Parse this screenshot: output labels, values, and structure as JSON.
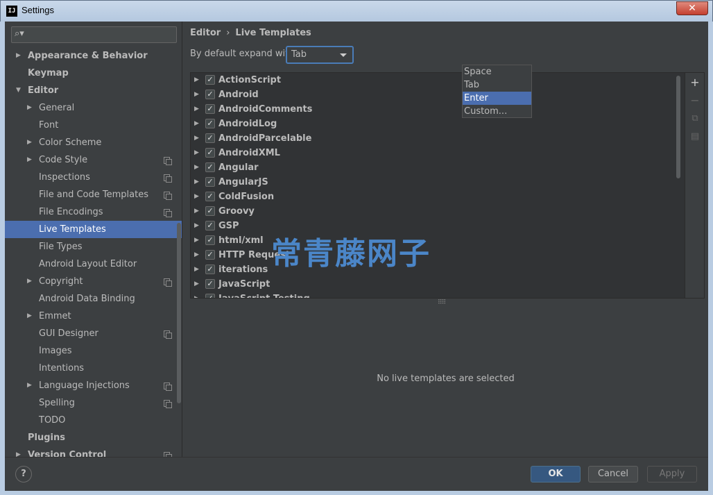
{
  "window": {
    "title": "Settings",
    "app_icon_text": "IJ",
    "close_glyph": "✕"
  },
  "sidebar": {
    "search": {
      "value": "",
      "icon": "search-icon"
    },
    "items": [
      {
        "label": "Appearance & Behavior",
        "level": 0,
        "arrow": "▶",
        "project": false,
        "selected": false
      },
      {
        "label": "Keymap",
        "level": 0,
        "arrow": "",
        "project": false,
        "selected": false
      },
      {
        "label": "Editor",
        "level": 0,
        "arrow": "▼",
        "project": false,
        "selected": false
      },
      {
        "label": "General",
        "level": 1,
        "arrow": "▶",
        "project": false,
        "selected": false
      },
      {
        "label": "Font",
        "level": 1,
        "arrow": "",
        "project": false,
        "selected": false
      },
      {
        "label": "Color Scheme",
        "level": 1,
        "arrow": "▶",
        "project": false,
        "selected": false
      },
      {
        "label": "Code Style",
        "level": 1,
        "arrow": "▶",
        "project": true,
        "selected": false
      },
      {
        "label": "Inspections",
        "level": 1,
        "arrow": "",
        "project": true,
        "selected": false
      },
      {
        "label": "File and Code Templates",
        "level": 1,
        "arrow": "",
        "project": true,
        "selected": false
      },
      {
        "label": "File Encodings",
        "level": 1,
        "arrow": "",
        "project": true,
        "selected": false
      },
      {
        "label": "Live Templates",
        "level": 1,
        "arrow": "",
        "project": false,
        "selected": true
      },
      {
        "label": "File Types",
        "level": 1,
        "arrow": "",
        "project": false,
        "selected": false
      },
      {
        "label": "Android Layout Editor",
        "level": 1,
        "arrow": "",
        "project": false,
        "selected": false
      },
      {
        "label": "Copyright",
        "level": 1,
        "arrow": "▶",
        "project": true,
        "selected": false
      },
      {
        "label": "Android Data Binding",
        "level": 1,
        "arrow": "",
        "project": false,
        "selected": false
      },
      {
        "label": "Emmet",
        "level": 1,
        "arrow": "▶",
        "project": false,
        "selected": false
      },
      {
        "label": "GUI Designer",
        "level": 1,
        "arrow": "",
        "project": true,
        "selected": false
      },
      {
        "label": "Images",
        "level": 1,
        "arrow": "",
        "project": false,
        "selected": false
      },
      {
        "label": "Intentions",
        "level": 1,
        "arrow": "",
        "project": false,
        "selected": false
      },
      {
        "label": "Language Injections",
        "level": 1,
        "arrow": "▶",
        "project": true,
        "selected": false
      },
      {
        "label": "Spelling",
        "level": 1,
        "arrow": "",
        "project": true,
        "selected": false
      },
      {
        "label": "TODO",
        "level": 1,
        "arrow": "",
        "project": false,
        "selected": false
      },
      {
        "label": "Plugins",
        "level": 0,
        "arrow": "",
        "project": false,
        "selected": false
      },
      {
        "label": "Version Control",
        "level": 0,
        "arrow": "▶",
        "project": true,
        "selected": false
      }
    ]
  },
  "main": {
    "breadcrumb": {
      "parent": "Editor",
      "separator": "›",
      "current": "Live Templates"
    },
    "expand": {
      "label": "By default expand with",
      "value": "Tab",
      "options": [
        {
          "label": "Space",
          "selected": false
        },
        {
          "label": "Tab",
          "selected": false
        },
        {
          "label": "Enter",
          "selected": true
        },
        {
          "label": "Custom...",
          "selected": false
        }
      ]
    },
    "templates": [
      "ActionScript",
      "Android",
      "AndroidComments",
      "AndroidLog",
      "AndroidParcelable",
      "AndroidXML",
      "Angular",
      "AngularJS",
      "ColdFusion",
      "Groovy",
      "GSP",
      "html/xml",
      "HTTP Request",
      "iterations",
      "JavaScript",
      "JavaScript Testing"
    ],
    "toolbar": {
      "add": "+",
      "remove": "−",
      "copy": "⧉",
      "restore": "▤"
    },
    "splitter": "⠿⠿",
    "empty_message": "No live templates are selected",
    "watermark": "常青藤网子"
  },
  "footer": {
    "help": "?",
    "ok": "OK",
    "cancel": "Cancel",
    "apply": "Apply"
  }
}
